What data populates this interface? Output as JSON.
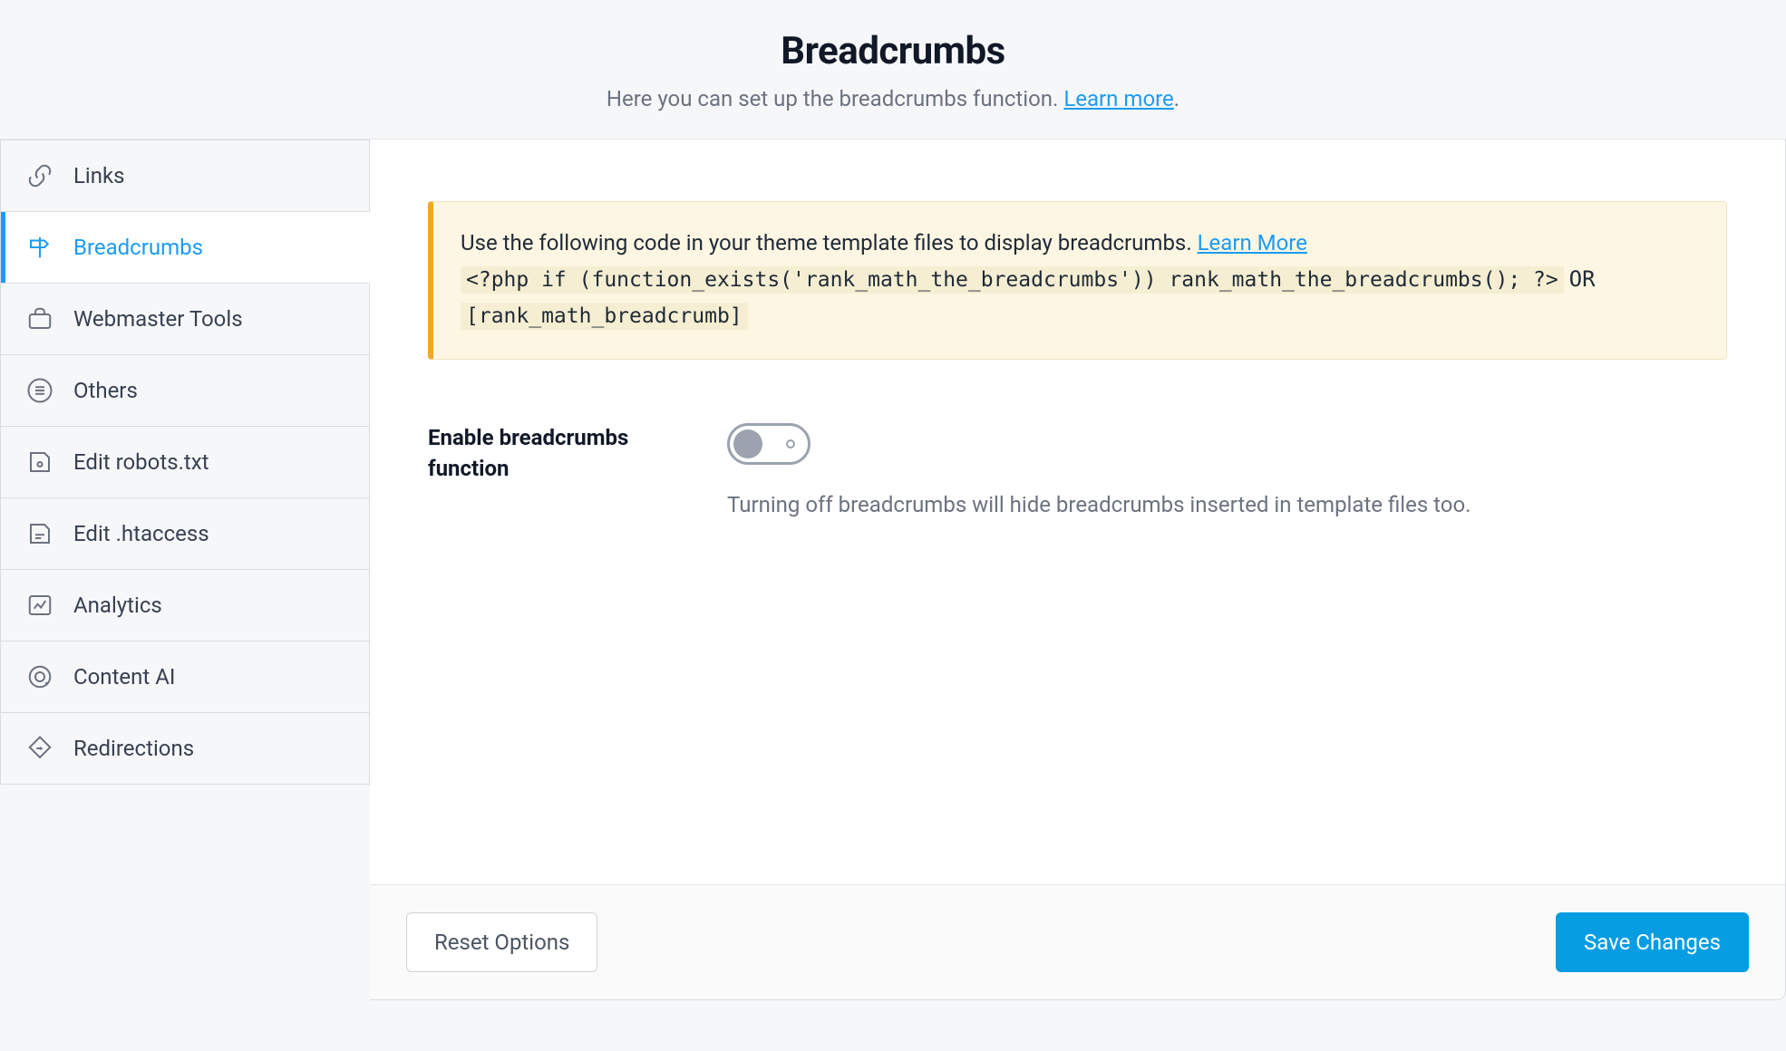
{
  "header": {
    "title": "Breadcrumbs",
    "subtitle_prefix": "Here you can set up the breadcrumbs function. ",
    "learn_more": "Learn more",
    "subtitle_suffix": "."
  },
  "sidebar": {
    "items": [
      {
        "label": "Links"
      },
      {
        "label": "Breadcrumbs"
      },
      {
        "label": "Webmaster Tools"
      },
      {
        "label": "Others"
      },
      {
        "label": "Edit robots.txt"
      },
      {
        "label": "Edit .htaccess"
      },
      {
        "label": "Analytics"
      },
      {
        "label": "Content AI"
      },
      {
        "label": "Redirections"
      }
    ]
  },
  "notice": {
    "text": "Use the following code in your theme template files to display breadcrumbs. ",
    "learn_more": "Learn More",
    "code_php": "<?php if (function_exists('rank_math_the_breadcrumbs')) rank_math_the_breadcrumbs(); ?>",
    "or": "OR",
    "code_short": "[rank_math_breadcrumb]"
  },
  "setting": {
    "label": "Enable breadcrumbs function",
    "help": "Turning off breadcrumbs will hide breadcrumbs inserted in template files too.",
    "value": false
  },
  "footer": {
    "reset": "Reset Options",
    "save": "Save Changes"
  }
}
